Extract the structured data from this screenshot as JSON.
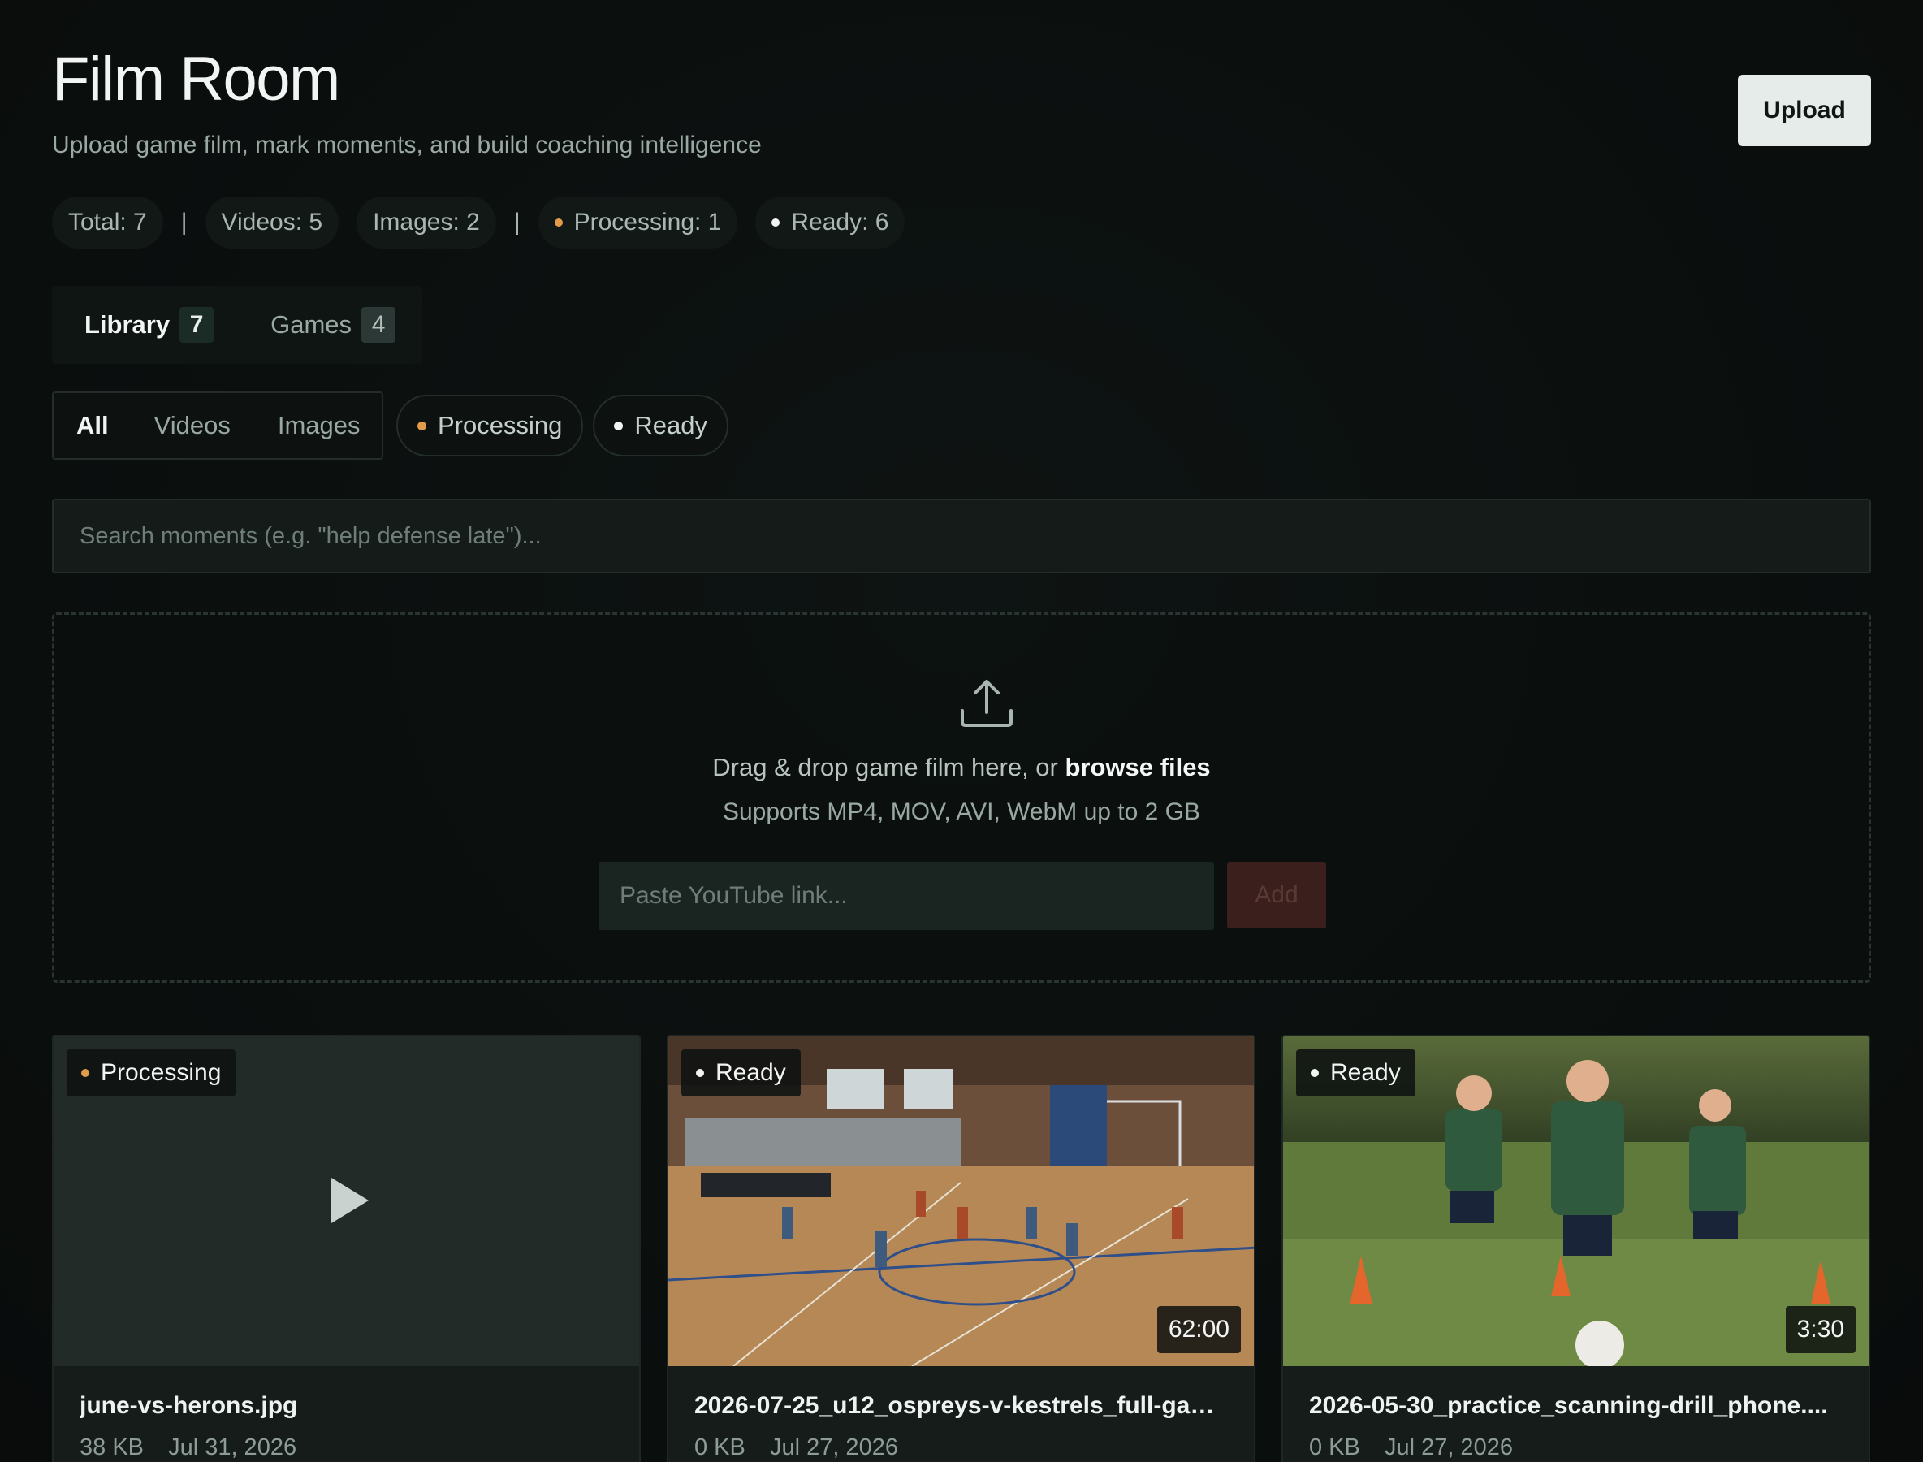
{
  "header": {
    "title": "Film Room",
    "subtitle": "Upload game film, mark moments, and build coaching intelligence",
    "upload_label": "Upload"
  },
  "stats": {
    "total": "Total: 7",
    "videos": "Videos: 5",
    "images": "Images: 2",
    "processing": "Processing: 1",
    "ready": "Ready: 6",
    "separator": "|"
  },
  "tabs": [
    {
      "label": "Library",
      "count": "7"
    },
    {
      "label": "Games",
      "count": "4"
    }
  ],
  "filters": {
    "types": [
      "All",
      "Videos",
      "Images"
    ],
    "processing": "Processing",
    "ready": "Ready"
  },
  "search": {
    "placeholder": "Search moments (e.g. \"help defense late\")..."
  },
  "dropzone": {
    "text": "Drag & drop game film here, or",
    "link": "browse files",
    "supports": "Supports MP4, MOV, AVI, WebM up to 2 GB",
    "youtube_placeholder": "Paste YouTube link...",
    "add_label": "Add"
  },
  "cards": [
    {
      "status": "Processing",
      "filename": "june-vs-herons.jpg",
      "size": "38 KB",
      "date": "Jul 31, 2026",
      "duration": ""
    },
    {
      "status": "Ready",
      "filename": "2026-07-25_u12_ospreys-v-kestrels_full-gam...",
      "size": "0 KB",
      "date": "Jul 27, 2026",
      "duration": "62:00"
    },
    {
      "status": "Ready",
      "filename": "2026-05-30_practice_scanning-drill_phone....",
      "size": "0 KB",
      "date": "Jul 27, 2026",
      "duration": "3:30"
    }
  ],
  "colors": {
    "processing_dot": "#e39a4b",
    "ready_dot": "#f2f5f3",
    "background": "#0b0f0e"
  }
}
